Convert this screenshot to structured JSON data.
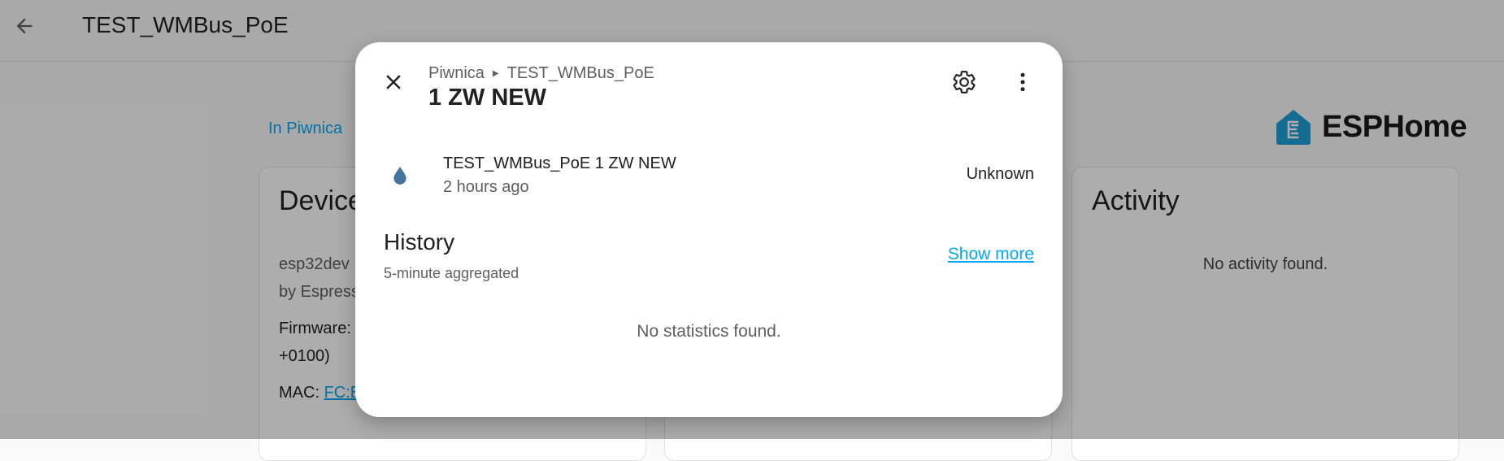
{
  "page": {
    "title": "TEST_WMBus_PoE",
    "area_link": "In Piwnica",
    "brand": {
      "name": "ESPHome",
      "color": "#1ea0d8"
    },
    "device_card": {
      "title": "Device",
      "model": "esp32dev",
      "manufacturer": "by Espress",
      "firmware_label": "Firmware:",
      "firmware_cont": "+0100)",
      "mac_label": "MAC:",
      "mac_value": "FC:E"
    },
    "activity_card": {
      "title": "Activity",
      "empty_text": "No activity found."
    }
  },
  "dialog": {
    "breadcrumb": [
      "Piwnica",
      "TEST_WMBus_PoE"
    ],
    "title": "1 ZW NEW",
    "close_icon": "close-icon",
    "settings_icon": "gear-icon",
    "more_icon": "more-vertical-icon",
    "entity": {
      "icon": "water-drop-icon",
      "icon_color": "#44739e",
      "name": "TEST_WMBus_PoE 1 ZW NEW",
      "last_changed": "2 hours ago",
      "state": "Unknown"
    },
    "history": {
      "title": "History",
      "subtitle": "5-minute aggregated",
      "show_more": "Show more",
      "empty_text": "No statistics found."
    }
  },
  "colors": {
    "accent": "#03a9f4",
    "scrim": "rgba(0,0,0,0.32)"
  }
}
